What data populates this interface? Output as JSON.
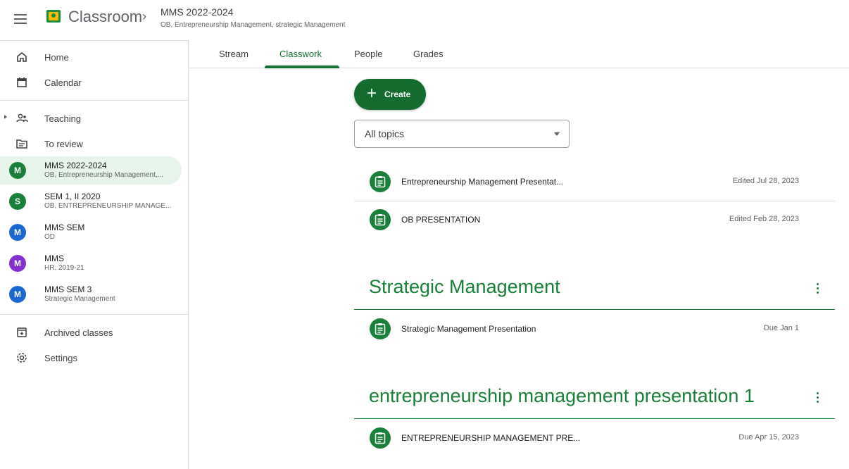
{
  "header": {
    "app_name": "Classroom",
    "class_title": "MMS 2022-2024",
    "class_subtitle": "OB, Entrepreneurship Management, strategic Management"
  },
  "sidebar": {
    "home": "Home",
    "calendar": "Calendar",
    "teaching": "Teaching",
    "to_review": "To review",
    "classes": [
      {
        "initial": "M",
        "title": "MMS 2022-2024",
        "sub": "OB, Entrepreneurship Management,...",
        "color": "#188038"
      },
      {
        "initial": "S",
        "title": "SEM 1, II 2020",
        "sub": "OB, ENTREPRENEURSHIP MANAGE...",
        "color": "#188038"
      },
      {
        "initial": "M",
        "title": "MMS SEM",
        "sub": "OD",
        "color": "#1967d2"
      },
      {
        "initial": "M",
        "title": "MMS",
        "sub": "HR, 2019-21",
        "color": "#8430ce"
      },
      {
        "initial": "M",
        "title": "MMS SEM 3",
        "sub": "Strategic Management",
        "color": "#1967d2"
      }
    ],
    "archived": "Archived classes",
    "settings": "Settings"
  },
  "tabs": [
    "Stream",
    "Classwork",
    "People",
    "Grades"
  ],
  "create_label": "Create",
  "filter": {
    "value": "All topics"
  },
  "items_untopiced": [
    {
      "name": "Entrepreneurship Management Presentat...",
      "date": "Edited Jul 28, 2023"
    },
    {
      "name": "OB PRESENTATION",
      "date": "Edited Feb 28, 2023"
    }
  ],
  "topics": [
    {
      "title": "Strategic Management",
      "items": [
        {
          "name": "Strategic Management Presentation",
          "date": "Due Jan 1"
        }
      ]
    },
    {
      "title": "entrepreneurship management presentation 1",
      "items": [
        {
          "name": "ENTREPRENEURSHIP MANAGEMENT PRE...",
          "date": "Due Apr 15, 2023"
        }
      ]
    }
  ],
  "colors": {
    "accent": "#188038",
    "create_bg": "#146c2e",
    "active_bg": "#e6f4ea"
  }
}
